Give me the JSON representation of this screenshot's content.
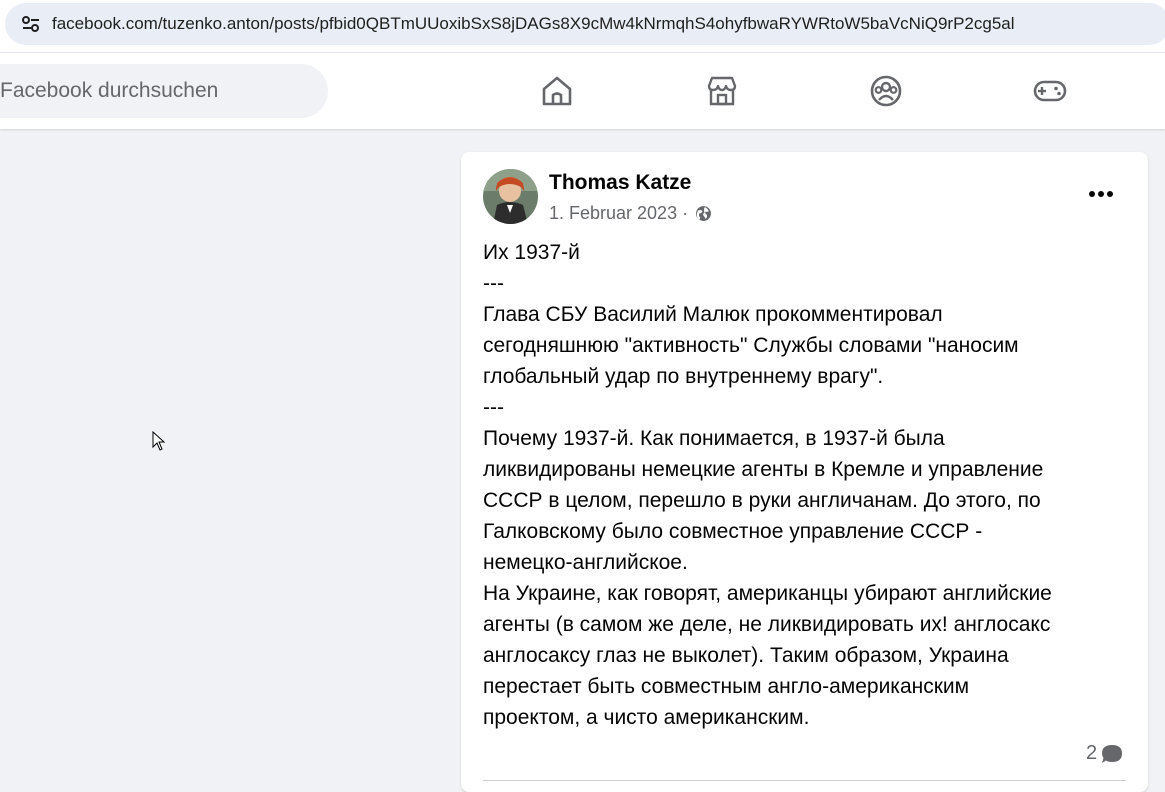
{
  "browser": {
    "url": "facebook.com/tuzenko.anton/posts/pfbid0QBTmUUoxibSxS8jDAGs8X9cMw4kNrmqhS4ohyfbwaRYWRtoW5baVcNiQ9rP2cg5al",
    "site_info_icon": "tune-icon"
  },
  "header": {
    "search_placeholder": "Facebook durchsuchen",
    "nav_icons": [
      "home-icon",
      "marketplace-icon",
      "groups-icon",
      "gaming-icon"
    ]
  },
  "post": {
    "author": "Thomas Katze",
    "date": "1. Februar 2023",
    "separator": "·",
    "privacy_icon": "globe-icon",
    "more_icon": "more-options-icon",
    "lines": [
      "Их 1937-й",
      "---",
      "Глава СБУ Василий Малюк прокомментировал",
      "сегодняшнюю \"активность\" Службы словами \"наносим",
      "глобальный удар по внутреннему врагу\".",
      "---",
      "Почему 1937-й. Как понимается, в 1937-й была",
      "ликвидированы немецкие агенты в Кремле и управление",
      "СССР в целом, перешло в руки англичанам. До этого, по",
      "Галковскому было совместное управление СССР -",
      "немецко-английское.",
      "На Украине, как говорят, американцы убирают  английские",
      "агенты (в самом же деле, не ликвидировать их! англосакс",
      "англосаксу глаз не выколет). Таким образом, Украина",
      "перестает быть совместным англо-американским",
      "проектом, а чисто американским."
    ],
    "comment_count": "2"
  }
}
